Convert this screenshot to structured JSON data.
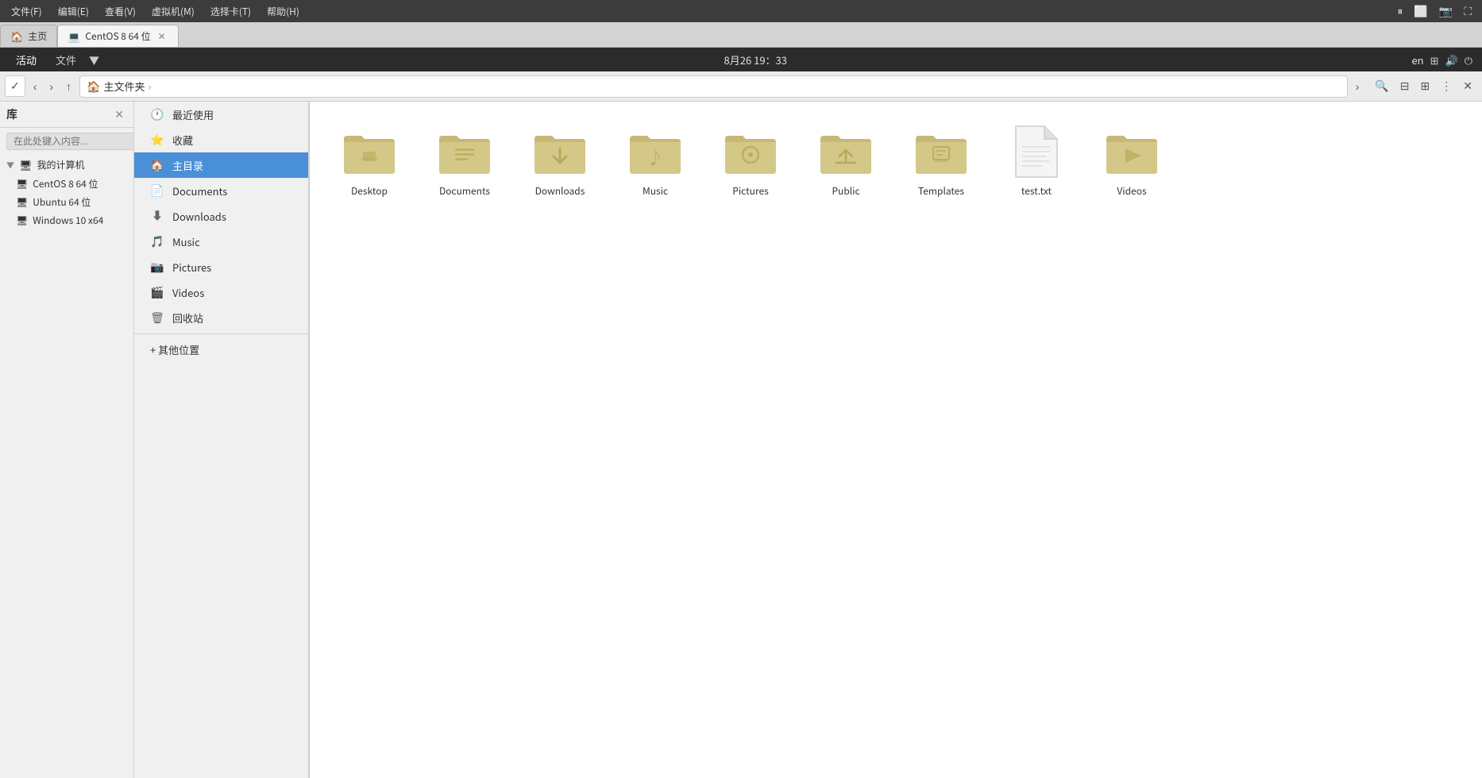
{
  "vm_toolbar": {
    "menu_items": [
      "文件(F)",
      "编辑(E)",
      "查看(V)",
      "虚拟机(M)",
      "选择卡(T)",
      "帮助(H)"
    ],
    "icons": [
      "⏸",
      "⬜",
      "↺",
      "⟳",
      "📷"
    ]
  },
  "top_bar": {
    "activities": "活动",
    "files": "文件",
    "datetime": "8月26 19：33",
    "lang": "en",
    "icons_right": [
      "🔊"
    ]
  },
  "tabs": [
    {
      "label": "主页",
      "icon": "🏠",
      "active": false
    },
    {
      "label": "CentOS 8 64 位",
      "icon": "💻",
      "active": true,
      "closeable": true
    }
  ],
  "nav": {
    "back": "‹",
    "forward": "›",
    "up": "↑",
    "breadcrumb_icon": "🏠",
    "breadcrumb_text": "主文件夹",
    "breadcrumb_arrow": "›"
  },
  "tree_panel": {
    "title": "库",
    "close_btn": "✕",
    "search_placeholder": "在此处键入内容...",
    "tree_items": [
      {
        "label": "我的计算机",
        "icon": "💻",
        "expanded": true,
        "indent": 0
      },
      {
        "label": "CentOS 8 64 位",
        "icon": "🖥",
        "indent": 1
      },
      {
        "label": "Ubuntu 64 位",
        "icon": "🖥",
        "indent": 1
      },
      {
        "label": "Windows 10 x64",
        "icon": "🖥",
        "indent": 1
      }
    ]
  },
  "sidebar": {
    "items": [
      {
        "label": "最近使用",
        "icon": "🕐",
        "active": false
      },
      {
        "label": "收藏",
        "icon": "⭐",
        "active": false
      },
      {
        "label": "主目录",
        "icon": "🏠",
        "active": true
      },
      {
        "label": "Documents",
        "icon": "📄",
        "active": false
      },
      {
        "label": "Downloads",
        "icon": "⬇",
        "active": false
      },
      {
        "label": "Music",
        "icon": "🎵",
        "active": false
      },
      {
        "label": "Pictures",
        "icon": "📷",
        "active": false
      },
      {
        "label": "Videos",
        "icon": "🎬",
        "active": false
      },
      {
        "label": "回收站",
        "icon": "🗑",
        "active": false
      }
    ],
    "other_label": "+ 其他位置"
  },
  "files": [
    {
      "name": "Desktop",
      "type": "folder",
      "variant": "desktop"
    },
    {
      "name": "Documents",
      "type": "folder",
      "variant": "documents"
    },
    {
      "name": "Downloads",
      "type": "folder",
      "variant": "downloads"
    },
    {
      "name": "Music",
      "type": "folder",
      "variant": "music"
    },
    {
      "name": "Pictures",
      "type": "folder",
      "variant": "pictures"
    },
    {
      "name": "Public",
      "type": "folder",
      "variant": "public"
    },
    {
      "name": "Templates",
      "type": "folder",
      "variant": "templates"
    },
    {
      "name": "test.txt",
      "type": "txt",
      "variant": "txt"
    },
    {
      "name": "Videos",
      "type": "folder",
      "variant": "videos"
    }
  ],
  "colors": {
    "folder_body": "#c8b878",
    "folder_tab": "#b8a060",
    "folder_dark": "#a08040",
    "accent_blue": "#4a90d9",
    "bg_main": "#ffffff",
    "text_dark": "#333333"
  }
}
